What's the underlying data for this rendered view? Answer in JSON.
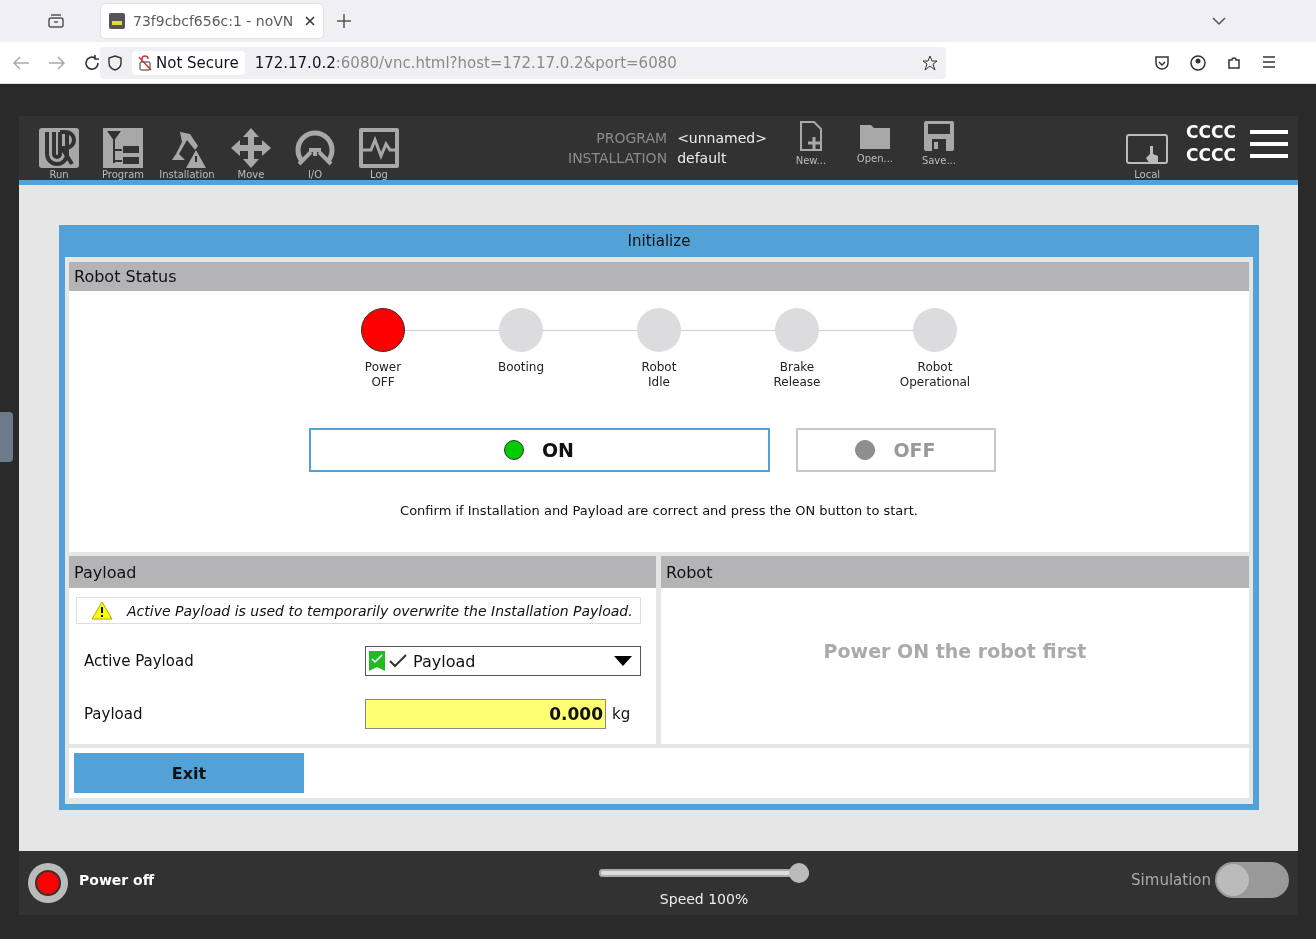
{
  "browser": {
    "tab_title": "73f9cbcf656c:1 - noVN",
    "security": "Not Secure",
    "url_host": "172.17.0.2",
    "url_rest": ":6080/vnc.html?host=172.17.0.2&port=6080"
  },
  "toolbar": {
    "nav": [
      {
        "kind": "run",
        "label": "Run"
      },
      {
        "kind": "program",
        "label": "Program"
      },
      {
        "kind": "installation",
        "label": "Installation"
      },
      {
        "kind": "move",
        "label": "Move"
      },
      {
        "kind": "io",
        "label": "I/O"
      },
      {
        "kind": "log",
        "label": "Log"
      }
    ],
    "program_label": "PROGRAM",
    "program_value": "<unnamed>",
    "installation_label": "INSTALLATION",
    "installation_value": "default",
    "files": [
      {
        "kind": "new",
        "label": "New..."
      },
      {
        "kind": "open",
        "label": "Open..."
      },
      {
        "kind": "save",
        "label": "Save..."
      }
    ],
    "local_label": "Local",
    "user_lines": [
      "CCCC",
      "CCCC"
    ]
  },
  "dialog": {
    "title": "Initialize",
    "robot_status": {
      "header": "Robot Status",
      "steps": [
        {
          "label": "Power OFF",
          "current": true
        },
        {
          "label": "Booting",
          "current": false
        },
        {
          "label": "Robot Idle",
          "current": false
        },
        {
          "label": "Brake Release",
          "current": false
        },
        {
          "label": "Robot Operational",
          "current": false
        }
      ],
      "buttons": [
        {
          "label": "ON",
          "disabled": false
        },
        {
          "label": "OFF",
          "disabled": true
        }
      ],
      "message": "Confirm if Installation and Payload are correct and press the ON button to start."
    },
    "payload": {
      "header": "Payload",
      "warning": "Active Payload is used to temporarily overwrite the Installation Payload.",
      "active_label": "Active Payload",
      "active_value": "Payload",
      "payload_label": "Payload",
      "payload_value": "0.000",
      "unit": "kg"
    },
    "robot": {
      "header": "Robot",
      "message": "Power ON the robot first"
    },
    "exit": "Exit"
  },
  "status_bar": {
    "power": "Power off",
    "speed": {
      "level": 1.0,
      "label": "Speed 100%"
    },
    "simulation": {
      "label": "Simulation",
      "on": false
    }
  }
}
